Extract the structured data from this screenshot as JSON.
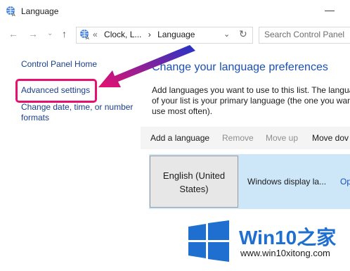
{
  "window": {
    "title": "Language",
    "minimize_glyph": "—"
  },
  "nav": {
    "back": "←",
    "forward": "→",
    "recent": "⌄",
    "up": "↑"
  },
  "address": {
    "crumbs": [
      "«",
      "Clock, L...",
      "›",
      "Language"
    ],
    "dropdown": "⌄",
    "refresh": "↻"
  },
  "search": {
    "placeholder": "Search Control Panel"
  },
  "sidebar": {
    "home": "Control Panel Home",
    "advanced": "Advanced settings",
    "change": "Change date, time, or number formats"
  },
  "main": {
    "title": "Change your language preferences",
    "desc_lines": [
      "Add languages you want to use to this list. The langua",
      "of your list is your primary language (the one you want",
      "use most often)."
    ]
  },
  "toolbar": {
    "add": "Add a language",
    "remove": "Remove",
    "move_up": "Move up",
    "move_down": "Move dov"
  },
  "language_item": {
    "name": "English (United States)",
    "status": "Windows display la...",
    "options": "Op"
  },
  "watermark": {
    "brand": "Win10之家",
    "url": "www.win10xitong.com"
  },
  "colors": {
    "accent_link": "#1a3e8c",
    "title_blue": "#1a4fb5",
    "highlight": "#e8106e",
    "selected_row": "#cde7f9",
    "watermark_blue": "#1e6fd0"
  },
  "icons": [
    "language-icon",
    "minimize-icon",
    "back-icon",
    "forward-icon",
    "recent-icon",
    "up-icon",
    "dropdown-icon",
    "refresh-icon",
    "windows-logo-icon",
    "arrow-annotation"
  ]
}
